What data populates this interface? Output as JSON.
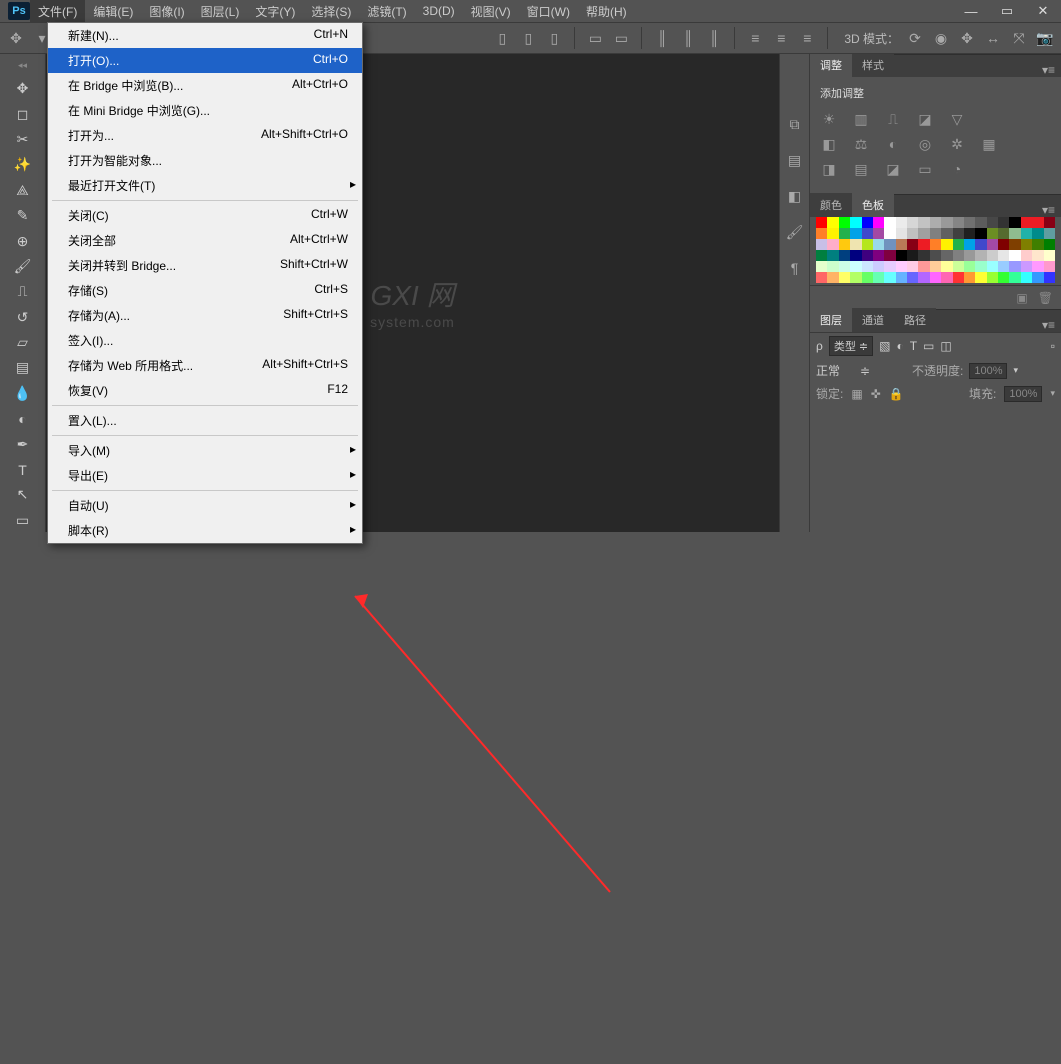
{
  "app": {
    "logo": "Ps"
  },
  "menubar": [
    {
      "label": "文件(F)",
      "active": true
    },
    {
      "label": "编辑(E)"
    },
    {
      "label": "图像(I)"
    },
    {
      "label": "图层(L)"
    },
    {
      "label": "文字(Y)"
    },
    {
      "label": "选择(S)"
    },
    {
      "label": "滤镜(T)"
    },
    {
      "label": "3D(D)"
    },
    {
      "label": "视图(V)"
    },
    {
      "label": "窗口(W)"
    },
    {
      "label": "帮助(H)"
    }
  ],
  "win_controls": {
    "min": "—",
    "max": "▭",
    "close": "✕"
  },
  "options_bar": {
    "mode_label": "3D 模式："
  },
  "file_menu": [
    {
      "label": "新建(N)...",
      "shortcut": "Ctrl+N"
    },
    {
      "label": "打开(O)...",
      "shortcut": "Ctrl+O",
      "selected": true
    },
    {
      "label": "在 Bridge 中浏览(B)...",
      "shortcut": "Alt+Ctrl+O"
    },
    {
      "label": "在 Mini Bridge 中浏览(G)..."
    },
    {
      "label": "打开为...",
      "shortcut": "Alt+Shift+Ctrl+O"
    },
    {
      "label": "打开为智能对象..."
    },
    {
      "label": "最近打开文件(T)",
      "submenu": true
    },
    {
      "sep": true
    },
    {
      "label": "关闭(C)",
      "shortcut": "Ctrl+W"
    },
    {
      "label": "关闭全部",
      "shortcut": "Alt+Ctrl+W"
    },
    {
      "label": "关闭并转到 Bridge...",
      "shortcut": "Shift+Ctrl+W"
    },
    {
      "label": "存储(S)",
      "shortcut": "Ctrl+S"
    },
    {
      "label": "存储为(A)...",
      "shortcut": "Shift+Ctrl+S"
    },
    {
      "label": "签入(I)..."
    },
    {
      "label": "存储为 Web 所用格式...",
      "shortcut": "Alt+Shift+Ctrl+S"
    },
    {
      "label": "恢复(V)",
      "shortcut": "F12"
    },
    {
      "sep": true
    },
    {
      "label": "置入(L)..."
    },
    {
      "sep": true
    },
    {
      "label": "导入(M)",
      "submenu": true
    },
    {
      "label": "导出(E)",
      "submenu": true
    },
    {
      "sep": true
    },
    {
      "label": "自动(U)",
      "submenu": true
    },
    {
      "label": "脚本(R)",
      "submenu": true
    }
  ],
  "watermark": {
    "main": "GXI 网",
    "sub": "system.com"
  },
  "panels": {
    "adjust": {
      "tabs": [
        "调整",
        "样式"
      ],
      "title": "添加调整"
    },
    "color": {
      "tabs": [
        "颜色",
        "色板"
      ]
    },
    "layers": {
      "tabs": [
        "图层",
        "通道",
        "路径"
      ],
      "kind": "类型",
      "blend": "正常",
      "opacity_label": "不透明度:",
      "opacity": "100%",
      "fill_label": "填充:",
      "fill": "100%",
      "lock_label": "锁定:"
    }
  },
  "swatch_colors": [
    "#ff0000",
    "#ffff00",
    "#00ff00",
    "#00ffff",
    "#0000ff",
    "#ff00ff",
    "#ffffff",
    "#ebebeb",
    "#d6d6d6",
    "#c2c2c2",
    "#adadad",
    "#999999",
    "#858585",
    "#707070",
    "#5c5c5c",
    "#474747",
    "#333333",
    "#000000",
    "#ec1c24",
    "#ec1c24",
    "#880015",
    "#ff7f27",
    "#fff200",
    "#22b14c",
    "#00a2e8",
    "#3f48cc",
    "#a349a4",
    "#ffffff",
    "#e4e4e4",
    "#c0c0c0",
    "#a0a0a0",
    "#808080",
    "#606060",
    "#404040",
    "#202020",
    "#000000",
    "#6b8e23",
    "#556b2f",
    "#8fbc8f",
    "#20b2aa",
    "#008b8b",
    "#5f9ea0",
    "#c8bfe7",
    "#ffaec9",
    "#ffc90e",
    "#efe4b0",
    "#b5e61d",
    "#99d9ea",
    "#7092be",
    "#b97a57",
    "#880015",
    "#ed1c24",
    "#ff7f27",
    "#fff200",
    "#22b14c",
    "#00a2e8",
    "#3f48cc",
    "#a349a4",
    "#7f0000",
    "#7f3f00",
    "#7f7f00",
    "#3f7f00",
    "#007f00",
    "#007f3f",
    "#007f7f",
    "#003f7f",
    "#00007f",
    "#3f007f",
    "#7f007f",
    "#7f003f",
    "#000000",
    "#1a1a1a",
    "#333333",
    "#4d4d4d",
    "#666666",
    "#808080",
    "#999999",
    "#b3b3b3",
    "#cccccc",
    "#e6e6e6",
    "#ffffff",
    "#ffcccc",
    "#ffe6cc",
    "#ffffcc",
    "#e6ffcc",
    "#ccffcc",
    "#ccffe6",
    "#ccffff",
    "#cce6ff",
    "#ccccff",
    "#e6ccff",
    "#ffccff",
    "#ffcce6",
    "#ff9999",
    "#ffcc99",
    "#ffff99",
    "#ccff99",
    "#99ff99",
    "#99ffcc",
    "#99ffff",
    "#99ccff",
    "#9999ff",
    "#cc99ff",
    "#ff99ff",
    "#ff99cc",
    "#ff6666",
    "#ffb366",
    "#ffff66",
    "#b3ff66",
    "#66ff66",
    "#66ffb3",
    "#66ffff",
    "#66b3ff",
    "#6666ff",
    "#b366ff",
    "#ff66ff",
    "#ff66b3",
    "#ff3333",
    "#ff9933",
    "#ffff33",
    "#99ff33",
    "#33ff33",
    "#33ff99",
    "#33ffff",
    "#3399ff",
    "#3333ff"
  ]
}
